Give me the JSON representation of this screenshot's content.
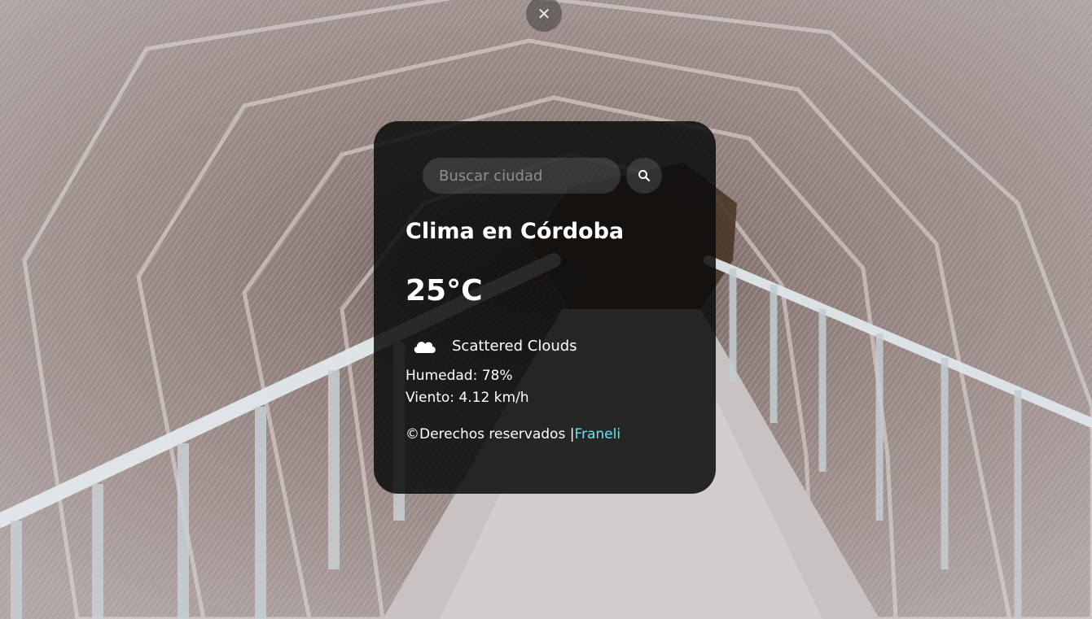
{
  "close_button": {
    "icon": "close-icon",
    "glyph": "✕"
  },
  "search": {
    "placeholder": "Buscar ciudad",
    "value": "",
    "button_icon": "search-icon"
  },
  "weather": {
    "title": "Clima en Córdoba",
    "temperature": "25°C",
    "icon": "cloud-icon",
    "description": "Scattered Clouds",
    "humidity": "Humedad: 78%",
    "wind": "Viento: 4.12 km/h"
  },
  "footer": {
    "copyright": "©Derechos reservados ",
    "separator": "|",
    "author_link": "Franeli"
  },
  "colors": {
    "card_background": "#0a0a0a",
    "link": "#5ee7f0",
    "text": "#ffffff"
  }
}
